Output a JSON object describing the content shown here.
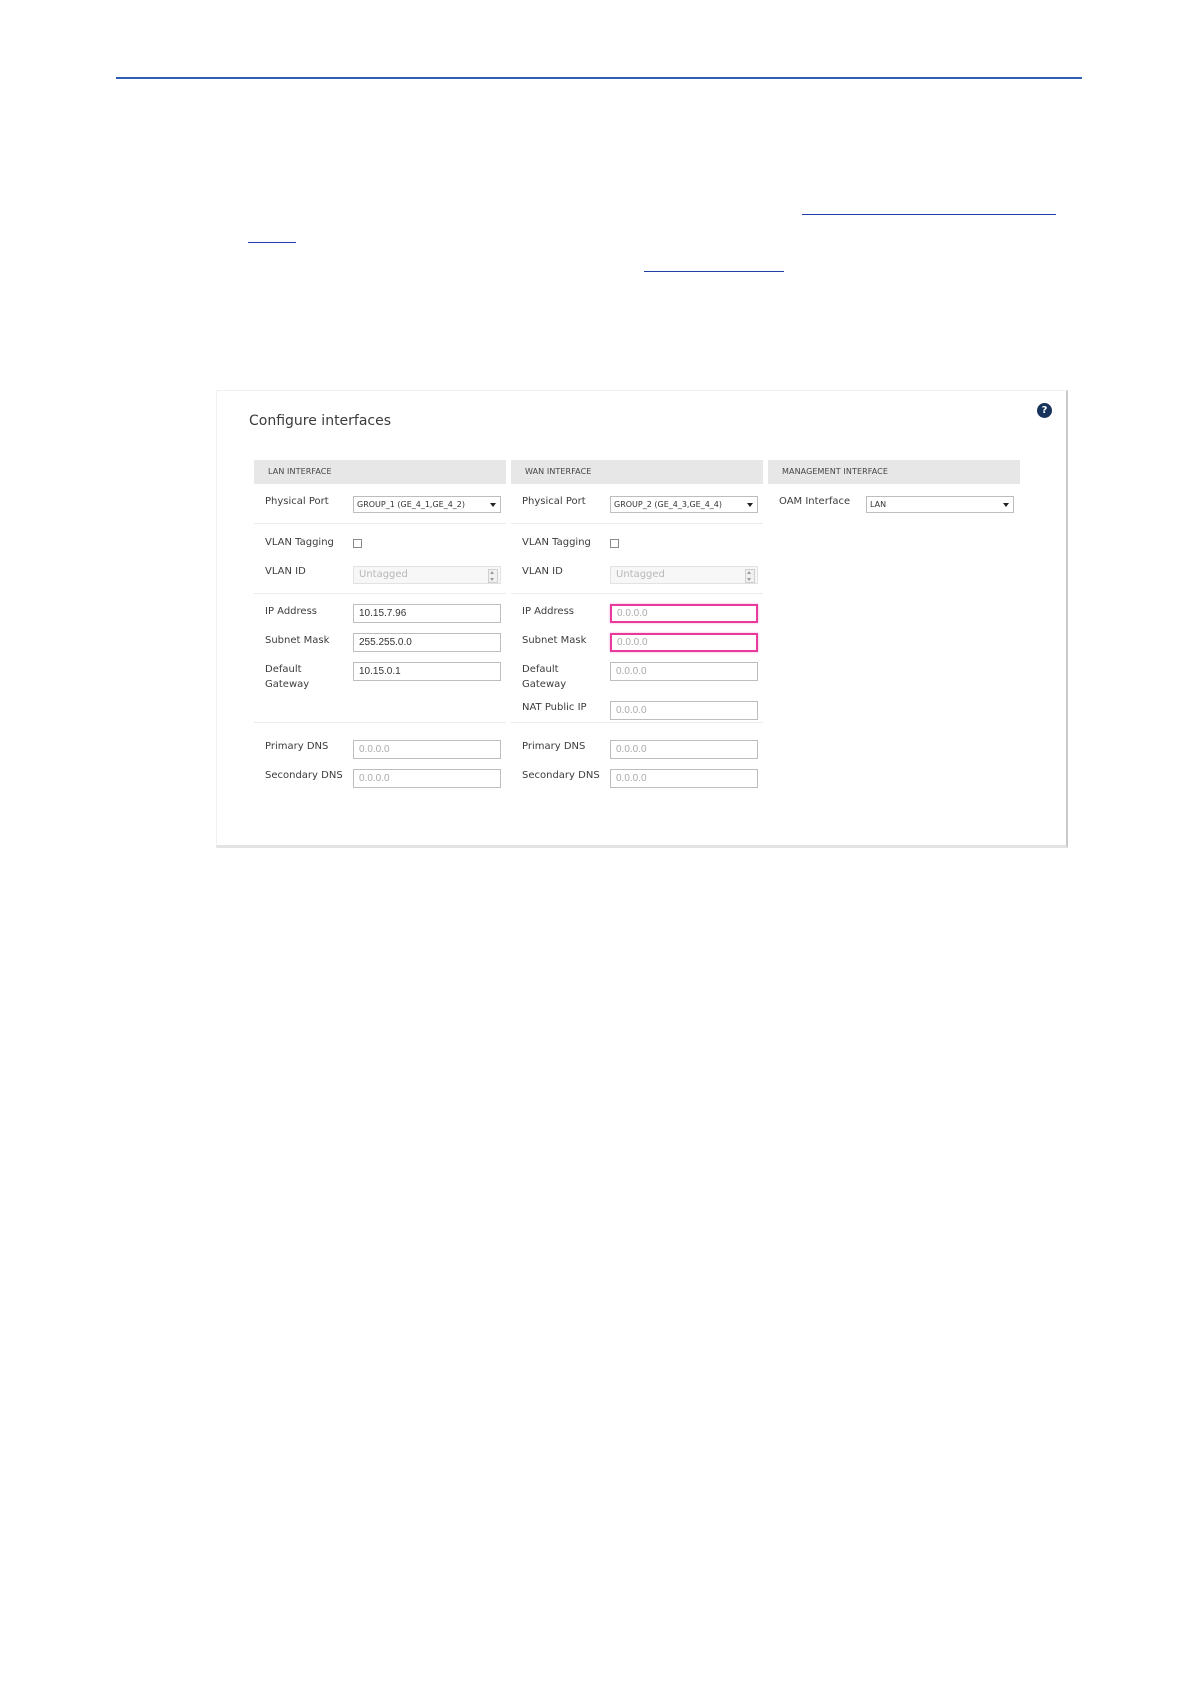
{
  "panel": {
    "title": "Configure interfaces",
    "help_icon": "?"
  },
  "lan": {
    "header": "LAN INTERFACE",
    "physical_port_label": "Physical Port",
    "physical_port_value": "GROUP_1 (GE_4_1,GE_4_2)",
    "vlan_tagging_label": "VLAN Tagging",
    "vlan_tagging_checked": false,
    "vlan_id_label": "VLAN ID",
    "vlan_id_placeholder": "Untagged",
    "ip_address_label": "IP Address",
    "ip_address_value": "10.15.7.96",
    "subnet_mask_label": "Subnet Mask",
    "subnet_mask_value": "255.255.0.0",
    "default_gateway_label": "Default Gateway",
    "default_gateway_value": "10.15.0.1",
    "primary_dns_label": "Primary DNS",
    "primary_dns_placeholder": "0.0.0.0",
    "secondary_dns_label": "Secondary DNS",
    "secondary_dns_placeholder": "0.0.0.0"
  },
  "wan": {
    "header": "WAN INTERFACE",
    "physical_port_label": "Physical Port",
    "physical_port_value": "GROUP_2 (GE_4_3,GE_4_4)",
    "vlan_tagging_label": "VLAN Tagging",
    "vlan_tagging_checked": false,
    "vlan_id_label": "VLAN ID",
    "vlan_id_placeholder": "Untagged",
    "ip_address_label": "IP Address",
    "ip_address_placeholder": "0.0.0.0",
    "subnet_mask_label": "Subnet Mask",
    "subnet_mask_placeholder": "0.0.0.0",
    "default_gateway_label": "Default Gateway",
    "default_gateway_placeholder": "0.0.0.0",
    "nat_public_ip_label": "NAT Public IP",
    "nat_public_ip_placeholder": "0.0.0.0",
    "primary_dns_label": "Primary DNS",
    "primary_dns_placeholder": "0.0.0.0",
    "secondary_dns_label": "Secondary DNS",
    "secondary_dns_placeholder": "0.0.0.0"
  },
  "management": {
    "header": "MANAGEMENT INTERFACE",
    "oam_interface_label": "OAM Interface",
    "oam_interface_value": "LAN"
  },
  "colors": {
    "top_rule": "#2e5fb5",
    "error_border": "#e8399d",
    "help_icon_bg": "#18335c",
    "section_header_bg": "#e7e7e7"
  }
}
